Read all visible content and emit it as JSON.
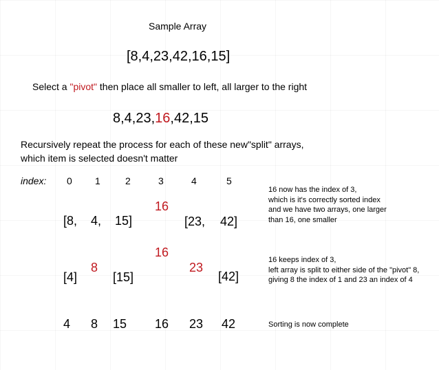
{
  "title": "Sample Array",
  "initial_array": "[8,4,23,42,16,15]",
  "instruction": {
    "before": "Select a ",
    "pivot_word": "\"pivot\"",
    "after": " then place all smaller to left, all larger to the right"
  },
  "pivot_array": {
    "before": "8,4,23,",
    "pivot": "16",
    "after": ",42,15"
  },
  "recursion_text": [
    "Recursively repeat the process for each of these new\"split\" arrays,",
    "which item is selected doesn't matter"
  ],
  "index_label": "index:",
  "indices": [
    "0",
    "1",
    "2",
    "3",
    "4",
    "5"
  ],
  "step1": {
    "left_items": [
      "[8,",
      "4,",
      "15]"
    ],
    "pivot": "16",
    "right_items": [
      "[23,",
      "42]"
    ],
    "note": [
      "16 now has the index of 3,",
      "which is it's correctly sorted index",
      "and we have two arrays, one larger",
      "than 16, one smaller"
    ]
  },
  "step2": {
    "left": "[4]",
    "left_pivot": "8",
    "middle": "[15]",
    "pivot": "16",
    "right_pivot": "23",
    "right": "[42]",
    "note": [
      "16 keeps index of 3,",
      "left array is split to either side of the \"pivot\" 8,",
      "giving 8 the index of 1 and 23 an index of 4"
    ]
  },
  "final": {
    "values": [
      "4",
      "8",
      "15",
      "16",
      "23",
      "42"
    ],
    "note": "Sorting is now complete"
  },
  "colors": {
    "accent": "#c0191f",
    "text": "#000000"
  }
}
